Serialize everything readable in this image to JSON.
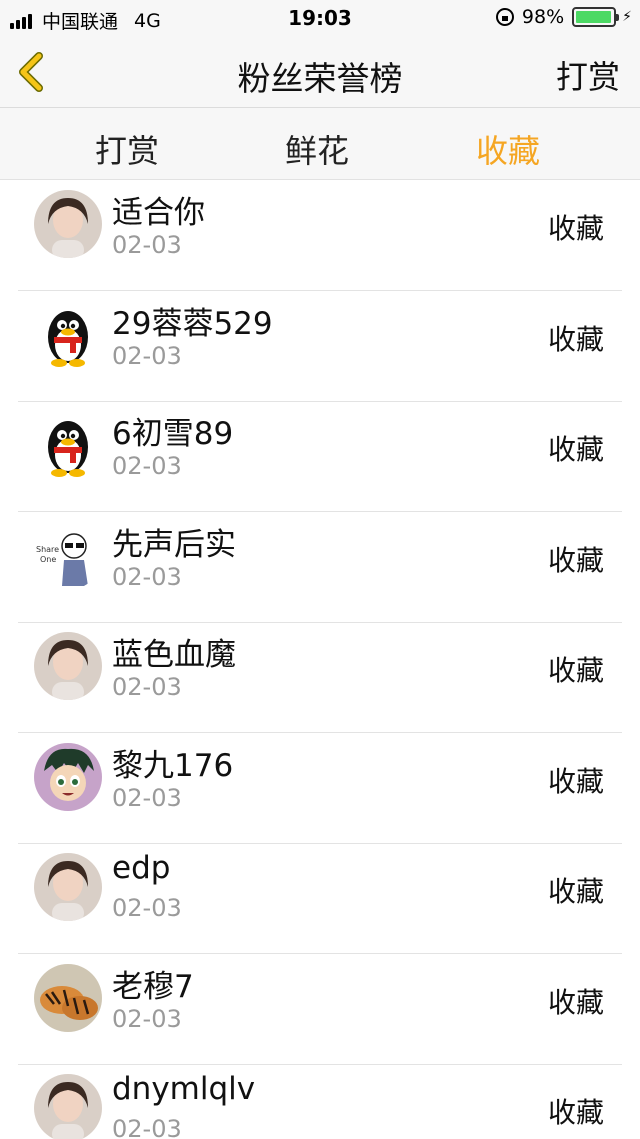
{
  "status_bar": {
    "carrier": "中国联通",
    "network": "4G",
    "time": "19:03",
    "battery": "98%",
    "battery_level": 0.98
  },
  "nav": {
    "back_icon": "chevron-left-icon",
    "title": "粉丝荣誉榜",
    "right_label": "打赏"
  },
  "tabs": [
    {
      "label": "打赏",
      "active": false
    },
    {
      "label": "鲜花",
      "active": false
    },
    {
      "label": "收藏",
      "active": true
    }
  ],
  "colors": {
    "accent": "#f5a623",
    "back_icon": "#f5c518",
    "date_text": "#9a9a9a"
  },
  "fans": [
    {
      "name": "适合你",
      "date": "02-03",
      "action": "收藏",
      "avatar": "photo-avatar"
    },
    {
      "name": "29蓉蓉529",
      "date": "02-03",
      "action": "收藏",
      "avatar": "penguin-avatar"
    },
    {
      "name": "6初雪89",
      "date": "02-03",
      "action": "收藏",
      "avatar": "penguin-avatar"
    },
    {
      "name": "先声后实",
      "date": "02-03",
      "action": "收藏",
      "avatar": "sketch-avatar"
    },
    {
      "name": "蓝色血魔",
      "date": "02-03",
      "action": "收藏",
      "avatar": "photo-avatar"
    },
    {
      "name": "黎九176",
      "date": "02-03",
      "action": "收藏",
      "avatar": "cartoon-avatar"
    },
    {
      "name": "edp",
      "date": "02-03",
      "action": "收藏",
      "avatar": "photo-avatar"
    },
    {
      "name": "老穆7",
      "date": "02-03",
      "action": "收藏",
      "avatar": "tiger-avatar"
    },
    {
      "name": "dnymlqlv",
      "date": "02-03",
      "action": "收藏",
      "avatar": "photo-avatar"
    }
  ]
}
